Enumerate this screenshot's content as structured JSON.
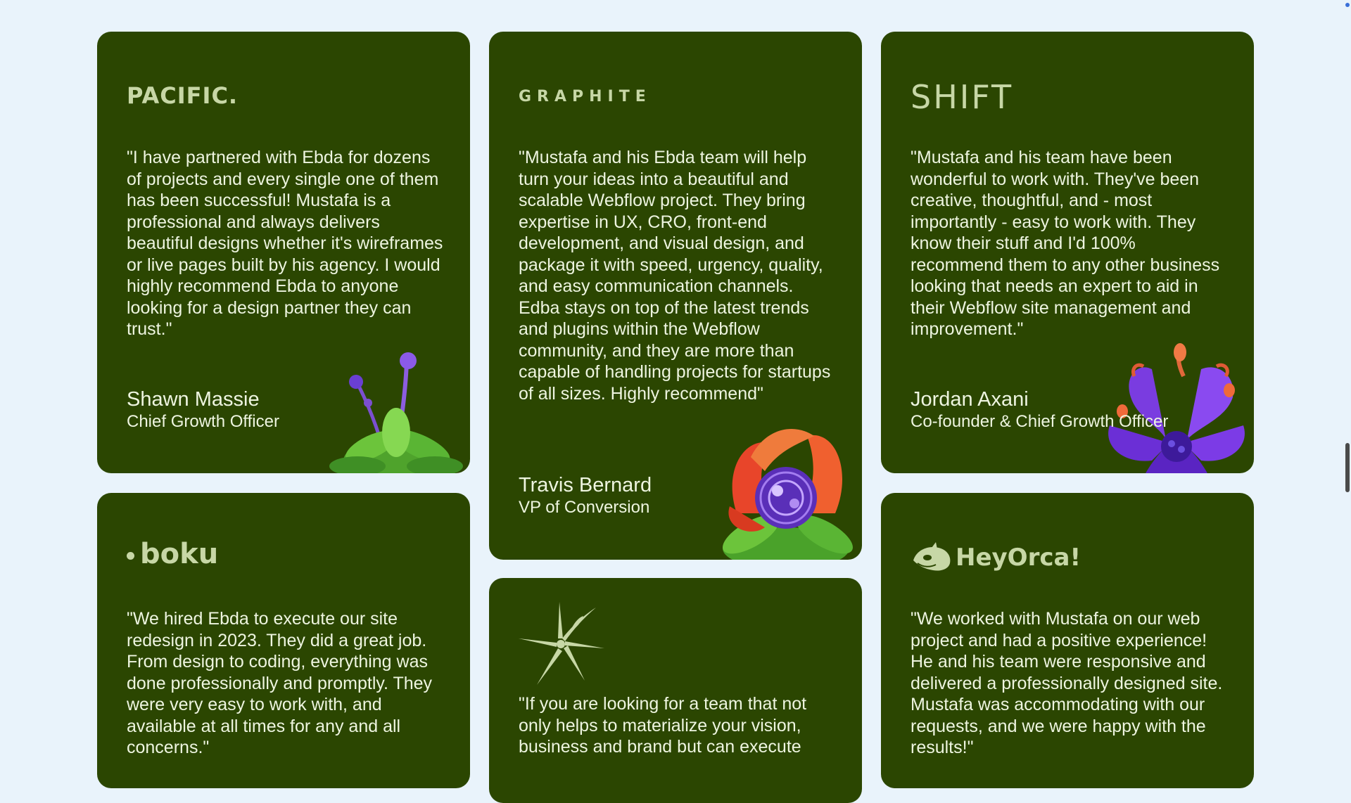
{
  "testimonials": [
    {
      "logo": "PACIFIC.",
      "quote": "\"I have partnered with Ebda for dozens of projects and every single one of them has been successful! Mustafa is a professional and always delivers beautiful designs whether it's wireframes or live pages built by his agency. I would highly recommend Ebda to anyone looking for a design partner they can trust.\"",
      "name": "Shawn Massie",
      "role": "Chief Growth Officer"
    },
    {
      "logo": "GRAPHITE",
      "quote": "\"Mustafa and his Ebda team will help turn your ideas into a beautiful and scalable Webflow project. They bring expertise in UX, CRO, front-end development, and visual design, and package it with speed, urgency, quality, and easy communication channels. Edba stays on top of the latest trends and plugins within the Webflow community, and they are more than capable of handling projects for startups of all sizes. Highly recommend\"",
      "name": "Travis Bernard",
      "role": "VP of Conversion"
    },
    {
      "logo": "SHIFT",
      "quote": "\"Mustafa and his team have been wonderful to work with. They've been creative, thoughtful, and - most importantly - easy to work with. They know their stuff and I'd 100% recommend them to any other business looking that needs an expert to aid in their Webflow site management and improvement.\"",
      "name": "Jordan Axani",
      "role": "Co-founder & Chief Growth Officer"
    },
    {
      "logo": "boku",
      "quote": "\"We hired Ebda to execute our site redesign in 2023. They did a great job. From design to coding, everything was done professionally and promptly. They were very easy to work with, and available at all times for any and all concerns.\""
    },
    {
      "logo_icon": "starburst-logo-icon",
      "quote": "\"If you are looking for a team that not only helps to materialize your vision, business and brand but can execute"
    },
    {
      "logo": "HeyOrca!",
      "quote": "\"We worked with Mustafa on our web project and had a positive experience! He and his team were responsive and delivered a professionally designed site. Mustafa was accommodating with our requests, and we were happy with the results!\""
    }
  ],
  "colors": {
    "page_background": "#e9f3fb",
    "card_background": "#2b4601",
    "logo_color": "#c7d7a6",
    "text_color": "#eef5e0"
  },
  "icons": {
    "flower_1": "green-plant-icon",
    "flower_2": "red-coral-flower-icon",
    "flower_3": "purple-flower-icon",
    "orca": "orca-icon"
  }
}
